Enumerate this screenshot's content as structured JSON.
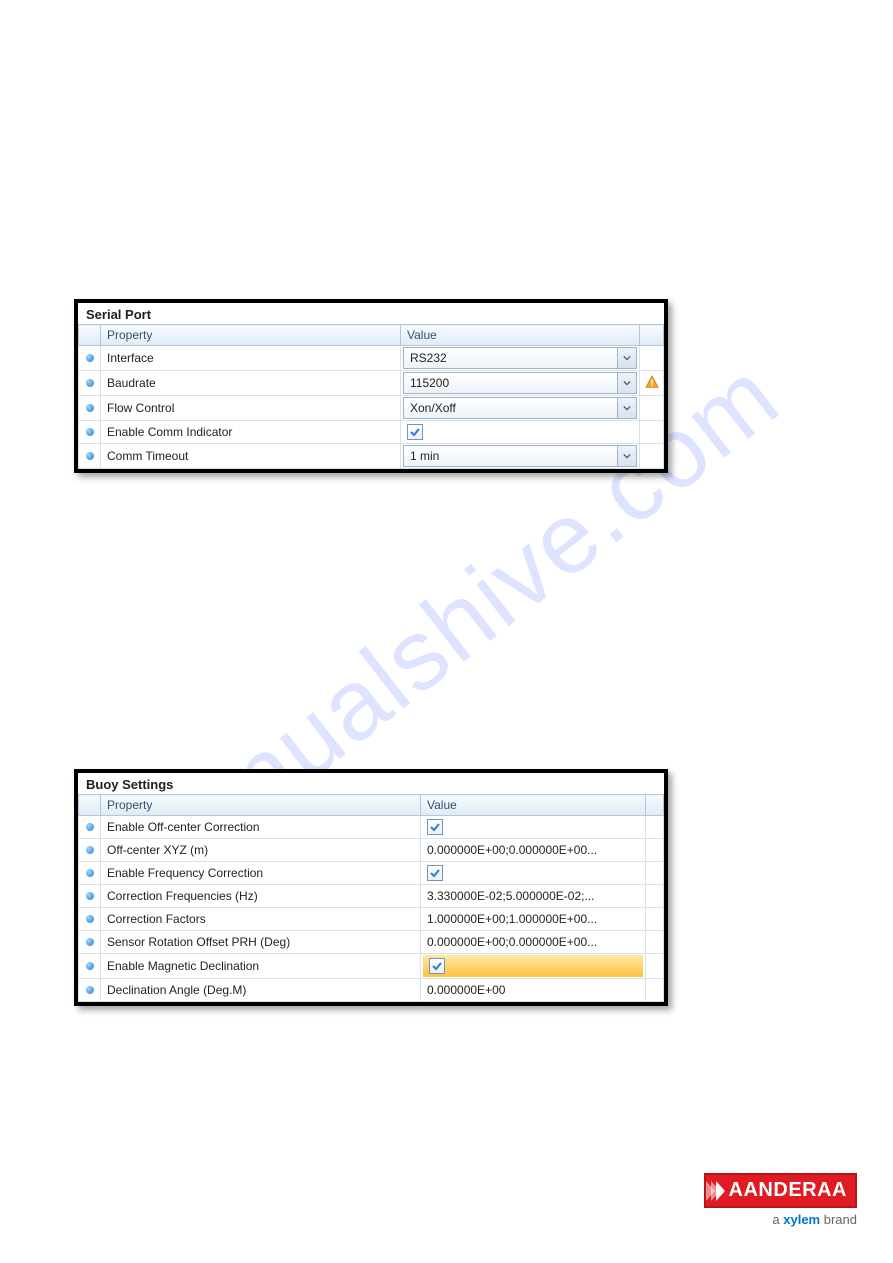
{
  "watermark": "manualshive.com",
  "brand": {
    "name": "AANDERAA",
    "tagline_prefix": "a ",
    "tagline_brand": "xylem",
    "tagline_suffix": " brand"
  },
  "serial": {
    "title": "Serial Port",
    "headers": {
      "property": "Property",
      "value": "Value"
    },
    "rows": [
      {
        "property": "Interface",
        "type": "dropdown",
        "value": "RS232",
        "warn": false
      },
      {
        "property": "Baudrate",
        "type": "dropdown",
        "value": "115200",
        "warn": true
      },
      {
        "property": "Flow Control",
        "type": "dropdown",
        "value": "Xon/Xoff",
        "warn": false
      },
      {
        "property": "Enable Comm Indicator",
        "type": "checkbox",
        "value": true,
        "warn": false
      },
      {
        "property": "Comm Timeout",
        "type": "dropdown",
        "value": "1 min",
        "warn": false
      }
    ]
  },
  "buoy": {
    "title": "Buoy Settings",
    "headers": {
      "property": "Property",
      "value": "Value"
    },
    "rows": [
      {
        "property": "Enable Off-center Correction",
        "type": "checkbox",
        "value": true
      },
      {
        "property": "Off-center XYZ (m)",
        "type": "text",
        "value": "0.000000E+00;0.000000E+00..."
      },
      {
        "property": "Enable Frequency Correction",
        "type": "checkbox",
        "value": true
      },
      {
        "property": "Correction Frequencies (Hz)",
        "type": "text",
        "value": "3.330000E-02;5.000000E-02;..."
      },
      {
        "property": "Correction Factors",
        "type": "text",
        "value": "1.000000E+00;1.000000E+00..."
      },
      {
        "property": "Sensor Rotation Offset PRH (Deg)",
        "type": "text",
        "value": "0.000000E+00;0.000000E+00..."
      },
      {
        "property": "Enable Magnetic Declination",
        "type": "checkbox",
        "value": true,
        "highlight": true
      },
      {
        "property": "Declination Angle (Deg.M)",
        "type": "text",
        "value": "0.000000E+00"
      }
    ]
  }
}
